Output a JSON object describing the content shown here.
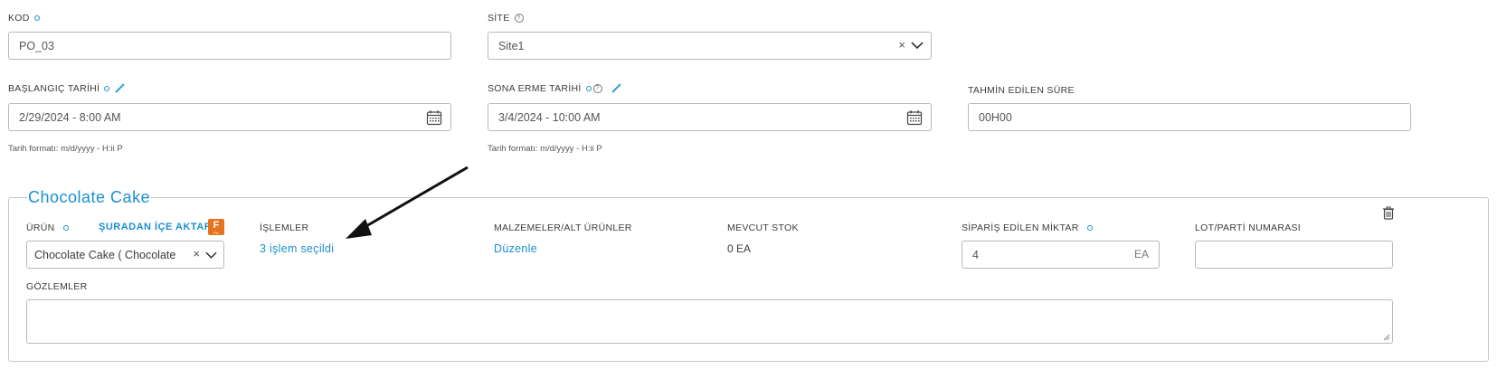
{
  "top_right_link": "",
  "kod": {
    "label": "KOD",
    "value": "PO_03"
  },
  "site": {
    "label": "SİTE",
    "value": "Site1"
  },
  "start_date": {
    "label": "BAŞLANGIÇ TARİHİ",
    "value": "2/29/2024 - 8:00 AM",
    "hint": "Tarih formatı: m/d/yyyy - H:ii P"
  },
  "end_date": {
    "label": "SONA ERME TARİHİ",
    "value": "3/4/2024 - 10:00 AM",
    "hint": "Tarih formatı: m/d/yyyy - H:ii P"
  },
  "duration": {
    "label": "TAHMİN EDİLEN SÜRE",
    "value": "00H00"
  },
  "product_group": {
    "title": "Chocolate Cake",
    "product": {
      "label": "ÜRÜN",
      "import_link": "ŞURADAN İÇE AKTAR:",
      "import_badge": "F",
      "value": "Chocolate Cake ( Chocolate"
    },
    "operations": {
      "label": "İŞLEMLER",
      "link": "3 işlem seçildi"
    },
    "materials": {
      "label": "MALZEMELER/ALT ÜRÜNLER",
      "link": "Düzenle"
    },
    "stock": {
      "label": "MEVCUT STOK",
      "value": "0 EA"
    },
    "ordered_qty": {
      "label": "SİPARİŞ EDİLEN MİKTAR",
      "value": "4",
      "unit": "EA"
    },
    "lot": {
      "label": "LOT/PARTİ NUMARASI",
      "value": ""
    },
    "notes": {
      "label": "GÖZLEMLER",
      "value": ""
    }
  },
  "colors": {
    "accent": "#1a8fd1",
    "border": "#b9b9b9",
    "badge": "#e8731f"
  },
  "icons": [
    "required-dot-icon",
    "help-icon",
    "magic-wand-icon",
    "calendar-icon",
    "clear-x-icon",
    "chevron-down-icon",
    "trash-icon",
    "annotation-arrow"
  ]
}
